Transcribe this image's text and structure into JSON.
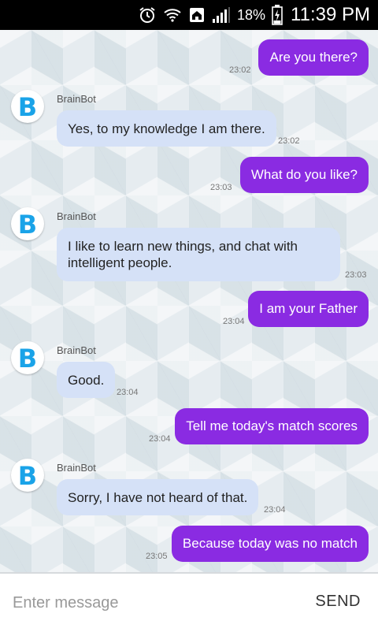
{
  "status_bar": {
    "battery_percent": "18%",
    "time": "11:39 PM",
    "icons": [
      "alarm-icon",
      "wifi-icon",
      "home-icon",
      "signal-icon",
      "battery-charging-icon"
    ]
  },
  "bot": {
    "name": "BrainBot",
    "avatar_letter": "B"
  },
  "messages": [
    {
      "sender": "user",
      "text": "Are you there?",
      "time": "23:02"
    },
    {
      "sender": "bot",
      "text": "Yes, to my knowledge I am there.",
      "time": "23:02"
    },
    {
      "sender": "user",
      "text": "What do you like?",
      "time": "23:03"
    },
    {
      "sender": "bot",
      "text": "I like to learn new things, and chat with intelligent people.",
      "time": "23:03"
    },
    {
      "sender": "user",
      "text": "I am your Father",
      "time": "23:04"
    },
    {
      "sender": "bot",
      "text": "Good.",
      "time": "23:04"
    },
    {
      "sender": "user",
      "text": "Tell me today's match scores",
      "time": "23:04"
    },
    {
      "sender": "bot",
      "text": "Sorry, I have not heard of that.",
      "time": "23:04"
    },
    {
      "sender": "user",
      "text": "Because today was no match",
      "time": "23:05"
    }
  ],
  "composer": {
    "placeholder": "Enter message",
    "value": "",
    "send_label": "SEND"
  },
  "colors": {
    "user_bubble": "#8a2be2",
    "bot_bubble": "#d5e1f7",
    "avatar_blue": "#1aa3e8"
  }
}
